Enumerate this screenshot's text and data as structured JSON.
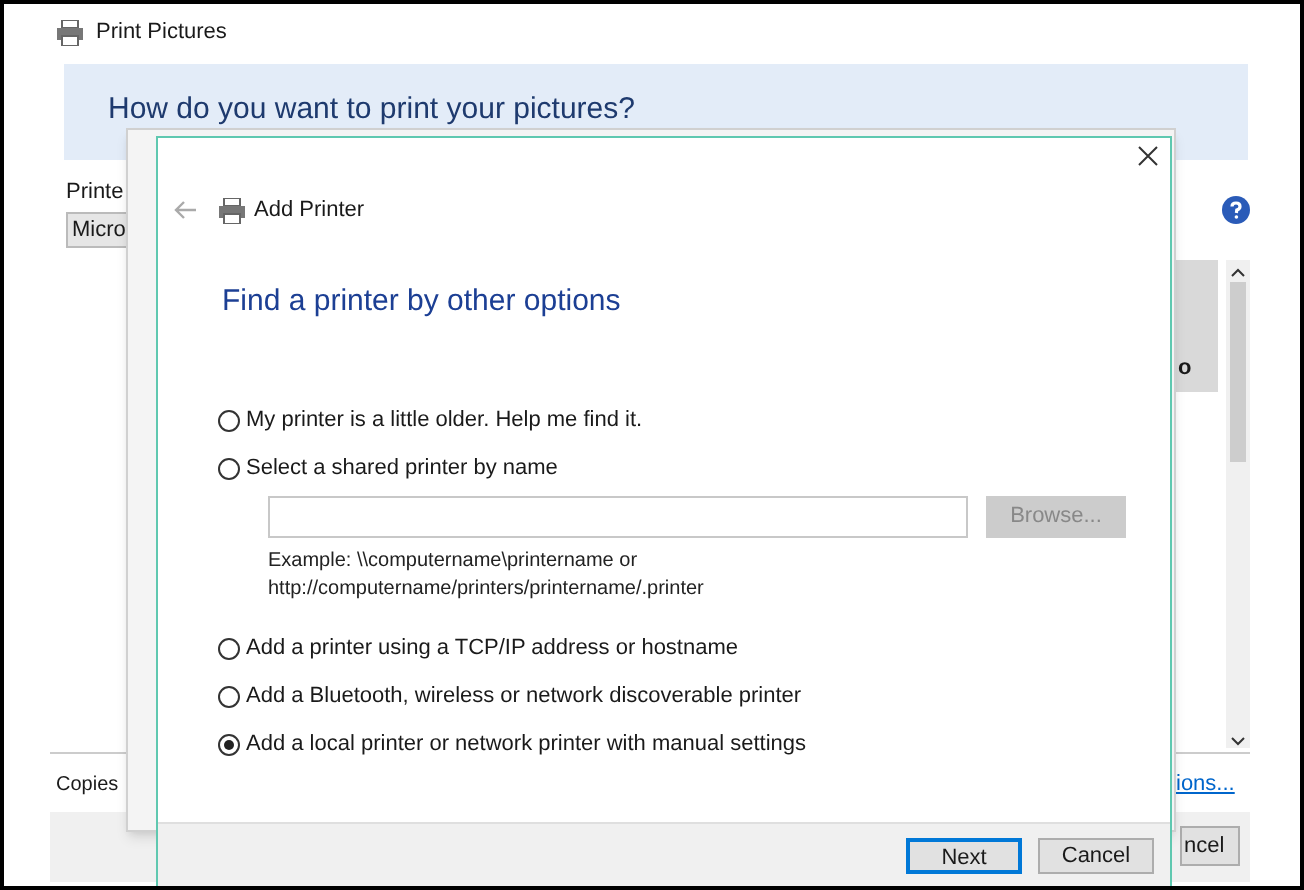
{
  "window": {
    "title": "Print Pictures",
    "heading": "How do you want to print your pictures?",
    "printer_label": "Printe",
    "printer_value": "Micro",
    "side_text": "o",
    "copies_label": "Copies",
    "options_link": "ions...",
    "cancel_button": "ncel"
  },
  "dialog": {
    "title": "Add Printer",
    "heading": "Find a printer by other options",
    "options": [
      {
        "label": "My printer is a little older. Help me find it.",
        "selected": false
      },
      {
        "label": "Select a shared printer by name",
        "selected": false,
        "kind": "field"
      },
      {
        "label": "Add a printer using a TCP/IP address or hostname",
        "selected": false
      },
      {
        "label": "Add a Bluetooth, wireless or network discoverable printer",
        "selected": false
      },
      {
        "label": "Add a local printer or network printer with manual settings",
        "selected": true
      }
    ],
    "browse_button": {
      "label": "Browse...",
      "disabled": true
    },
    "example_lines": [
      "Example: \\\\computername\\printername or",
      "http://computername/printers/printername/.printer"
    ],
    "buttons": [
      {
        "label": "Next",
        "selected": true
      },
      {
        "label": "Cancel",
        "selected": false
      }
    ]
  }
}
